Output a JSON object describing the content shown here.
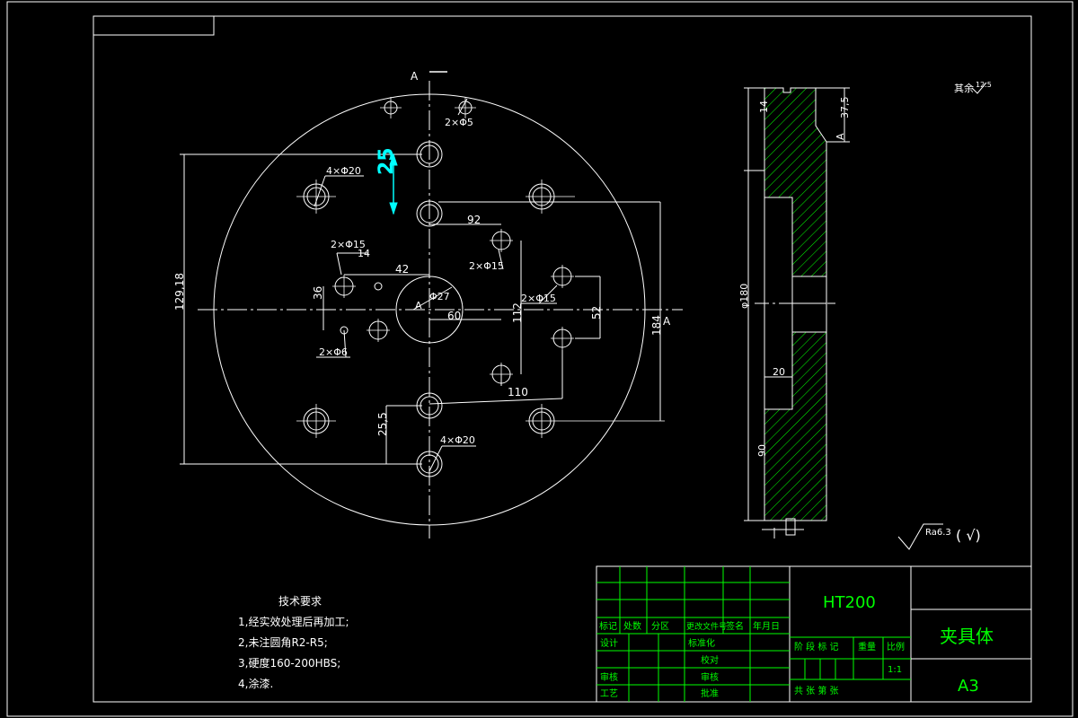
{
  "section_marks": {
    "top": "A",
    "right": "A",
    "side": "A",
    "center": "A"
  },
  "dimensions": {
    "d25": "25",
    "d92": "92",
    "d42": "42",
    "d14": "14",
    "d36": "36",
    "d60": "60",
    "d112": "112",
    "d52": "52",
    "d184": "184",
    "d110": "110",
    "d25_5": "25,5",
    "d129_18": "129,18",
    "d180": "φ180",
    "d37_5": "37,5",
    "d20": "20",
    "d90": "90",
    "d14s": "14"
  },
  "callouts": {
    "c_4x20_top": "4×Φ20",
    "c_2x5": "2×Φ5",
    "c_2x15_left": "2×Φ15",
    "c_2x15_mid": "2×Φ15",
    "c_2x15_right": "2×Φ15",
    "c_27": "Φ27",
    "c_2x6": "2×Φ6",
    "c_4x20_bot": "4×Φ20"
  },
  "surface": {
    "rest_note": "其余",
    "rest_ra": "12.5",
    "ra_value": "Ra6.3",
    "paren": "(  √)"
  },
  "tech_requirements": {
    "title": "技术要求",
    "items": [
      "1,经实效处理后再加工;",
      "2,未注圆角R2-R5;",
      "3,硬度160-200HBS;",
      "4,涂漆."
    ]
  },
  "title_block": {
    "material": "HT200",
    "part_name": "夹具体",
    "sheet_size": "A3",
    "row_headers": [
      "标记",
      "处数",
      "分区",
      "更改文件号",
      "签名",
      "年月日"
    ],
    "design": "设计",
    "standardize": "标准化",
    "stage_mark": "阶 段 标 记",
    "weight": "重量",
    "scale_label": "比例",
    "check": "审核",
    "craft": "工艺",
    "proof": "校对",
    "audit": "审核",
    "approve": "批准",
    "scale_value": "1:1",
    "sheets_text": "共     张 第     张"
  },
  "colors": {
    "outline": "#ffffff",
    "dimension_highlight": "#00ffff",
    "titleblock": "#00ff00",
    "hatch": "#00ff00"
  }
}
